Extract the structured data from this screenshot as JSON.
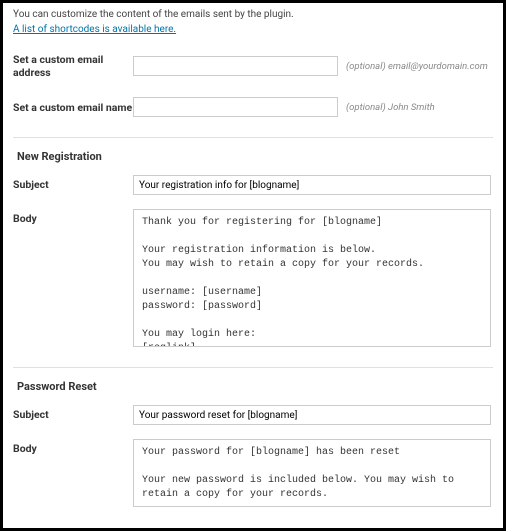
{
  "intro": {
    "text": "You can customize the content of the emails sent by the plugin.",
    "link_text": "A list of shortcodes is available here."
  },
  "custom_email": {
    "address_label": "Set a custom email address",
    "address_hint": "(optional) email@yourdomain.com",
    "name_label": "Set a custom email name",
    "name_hint": "(optional) John Smith"
  },
  "sections": {
    "new_registration": {
      "title": "New Registration",
      "subject_label": "Subject",
      "subject_value": "Your registration info for [blogname]",
      "body_label": "Body",
      "body_value": "Thank you for registering for [blogname]\n\nYour registration information is below.\nYou may wish to retain a copy for your records.\n\nusername: [username]\npassword: [password]\n\nYou may login here:\n[reglink]\n\nYou may change your password here:\n[members-area]"
    },
    "password_reset": {
      "title": "Password Reset",
      "subject_label": "Subject",
      "subject_value": "Your password reset for [blogname]",
      "body_label": "Body",
      "body_value": "Your password for [blogname] has been reset\n\nYour new password is included below. You may wish to retain a copy for your records.\n\npassword: [password]"
    }
  }
}
